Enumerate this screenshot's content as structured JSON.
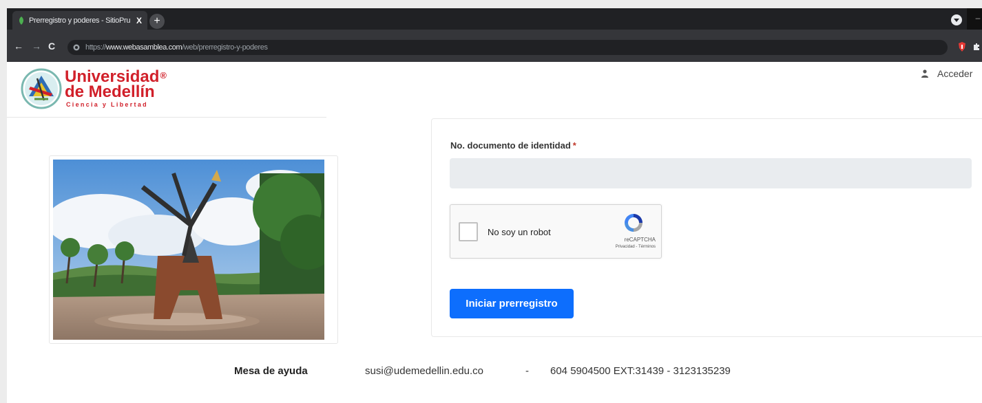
{
  "browser": {
    "tab_title": "Prerregistro y poderes - SitioPru",
    "tab_close": "X",
    "new_tab": "+",
    "minimize": "–",
    "url_scheme": "https://",
    "url_host": "www.webasamblea.com",
    "url_path": "/web/prerregistro-y-poderes",
    "back": "←",
    "forward": "→",
    "reload": "C"
  },
  "header": {
    "logo_line1": "Universidad",
    "logo_reg": "®",
    "logo_line2": "de Medellín",
    "logo_motto": "Ciencia y Libertad",
    "login_label": "Acceder"
  },
  "form": {
    "doc_label": "No. documento de identidad",
    "required_mark": "*",
    "doc_value": "",
    "recaptcha_label": "No soy un robot",
    "recaptcha_brand": "reCAPTCHA",
    "recaptcha_links": "Privacidad - Términos",
    "submit_label": "Iniciar prerregistro"
  },
  "footer": {
    "help_label": "Mesa de ayuda",
    "email": "susi@udemedellin.edu.co",
    "separator": "-",
    "phones": "604 5904500 EXT:31439 - 3123135239"
  },
  "colors": {
    "brand_red": "#d1202a",
    "primary_button": "#0d6efd",
    "input_background": "#e9ecef"
  }
}
